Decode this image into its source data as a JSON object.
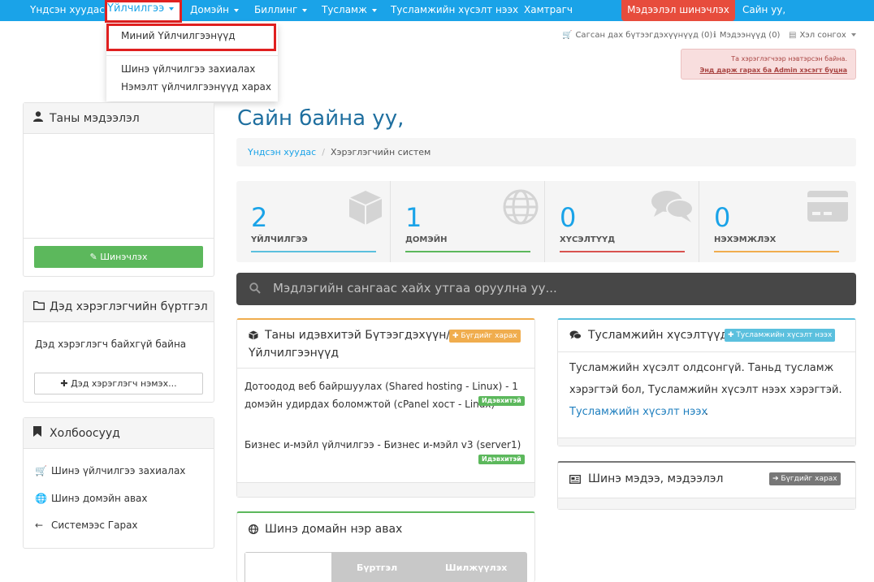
{
  "nav": {
    "home": "Үндсэн хуудас",
    "services": "Үйлчилгээ",
    "domain": "Домэйн",
    "billing": "Биллинг",
    "support": "Тусламж",
    "open_ticket": "Тусламжийн хүсэлт нээх",
    "affiliates": "Хамтрагч",
    "update_info": "Мэдээлэл шинэчлэх",
    "greeting": "Сайн уу,"
  },
  "dropdown": {
    "items": [
      "Миний Үйлчилгээнүүд",
      "Шинэ үйлчилгээ захиалах",
      "Нэмэлт үйлчилгээнүүд харах"
    ]
  },
  "util": {
    "cart": "Сагсан дах бүтээгдэхүүнүүд (0)",
    "notifications": "Мэдээнүүд (0)",
    "language": "Хэл сонгох"
  },
  "admin_alert": {
    "text": "Та хэрэглэгчээр нэвтэрсэн байна.",
    "link": "Энд дарж гарах ба Admin хэсэгт буцна"
  },
  "sidebar": {
    "info_title": "Таны мэдээлэл",
    "update_btn": "Шинэчлэх",
    "contacts_title": "Дэд хэрэглэгчийн бүртгэл",
    "contacts_empty": "Дэд хэрэглэгч байхгүй байна",
    "add_contact_btn": "Дэд хэрэглэгч нэмэх...",
    "links_title": "Холбоосууд",
    "links": [
      "Шинэ үйлчилгээ захиалах",
      "Шинэ домэйн авах",
      "Системээс Гарах"
    ]
  },
  "main": {
    "title": "Сайн байна уу,",
    "breadcrumb_home": "Үндсэн хуудас",
    "breadcrumb_current": "Хэрэглэгчийн систем",
    "stats": [
      {
        "num": "2",
        "label": "ҮЙЛЧИЛГЭЭ",
        "color": "#5bc0de"
      },
      {
        "num": "1",
        "label": "ДОМЭЙН",
        "color": "#5cb85c"
      },
      {
        "num": "0",
        "label": "ХҮСЭЛТҮҮД",
        "color": "#d9534f"
      },
      {
        "num": "0",
        "label": "НЭХЭМЖЛЭХ",
        "color": "#f0ad4e"
      }
    ],
    "search_placeholder": "Мэдлэгийн сангаас хайх утгаа оруулна уу..."
  },
  "products_card": {
    "title_line1": "Таны идэвхитэй Бүтээгдэхүүн/",
    "title_line2": "Үйлчилгээнүүд",
    "view_all": "Бүгдийг харах",
    "items": [
      {
        "line1": "Дотоодод веб байршуулах (Shared hosting - Linux) - 1",
        "line2": "домэйн удирдах боломжтой (cPanel хост - Linux)",
        "tag": "Идэвхитэй"
      },
      {
        "line1": "Бизнес и-мэйл үйлчилгээ - Бизнес и-мэйл v3 (server1)",
        "line2": "",
        "tag": "Идэвхитэй"
      }
    ]
  },
  "tickets_card": {
    "title": "Тусламжийн хүсэлтүүд",
    "open_btn": "Тусламжийн хүсэлт нээх",
    "line1": "Тусламжийн хүсэлт олдсонгүй. Таньд тусламж",
    "line2": "хэрэгтэй бол, Тусламжийн хүсэлт нээх хэрэгтэй.",
    "link": "Тусламжийн хүсэлт нээх"
  },
  "news_card": {
    "title": "Шинэ мэдээ, мэдээлэл",
    "view_all": "Бүгдийг харах"
  },
  "domain_card": {
    "title": "Шинэ домайн нэр авах",
    "tabs": [
      "Бүртгэл",
      "Шилжүүлэх"
    ]
  }
}
